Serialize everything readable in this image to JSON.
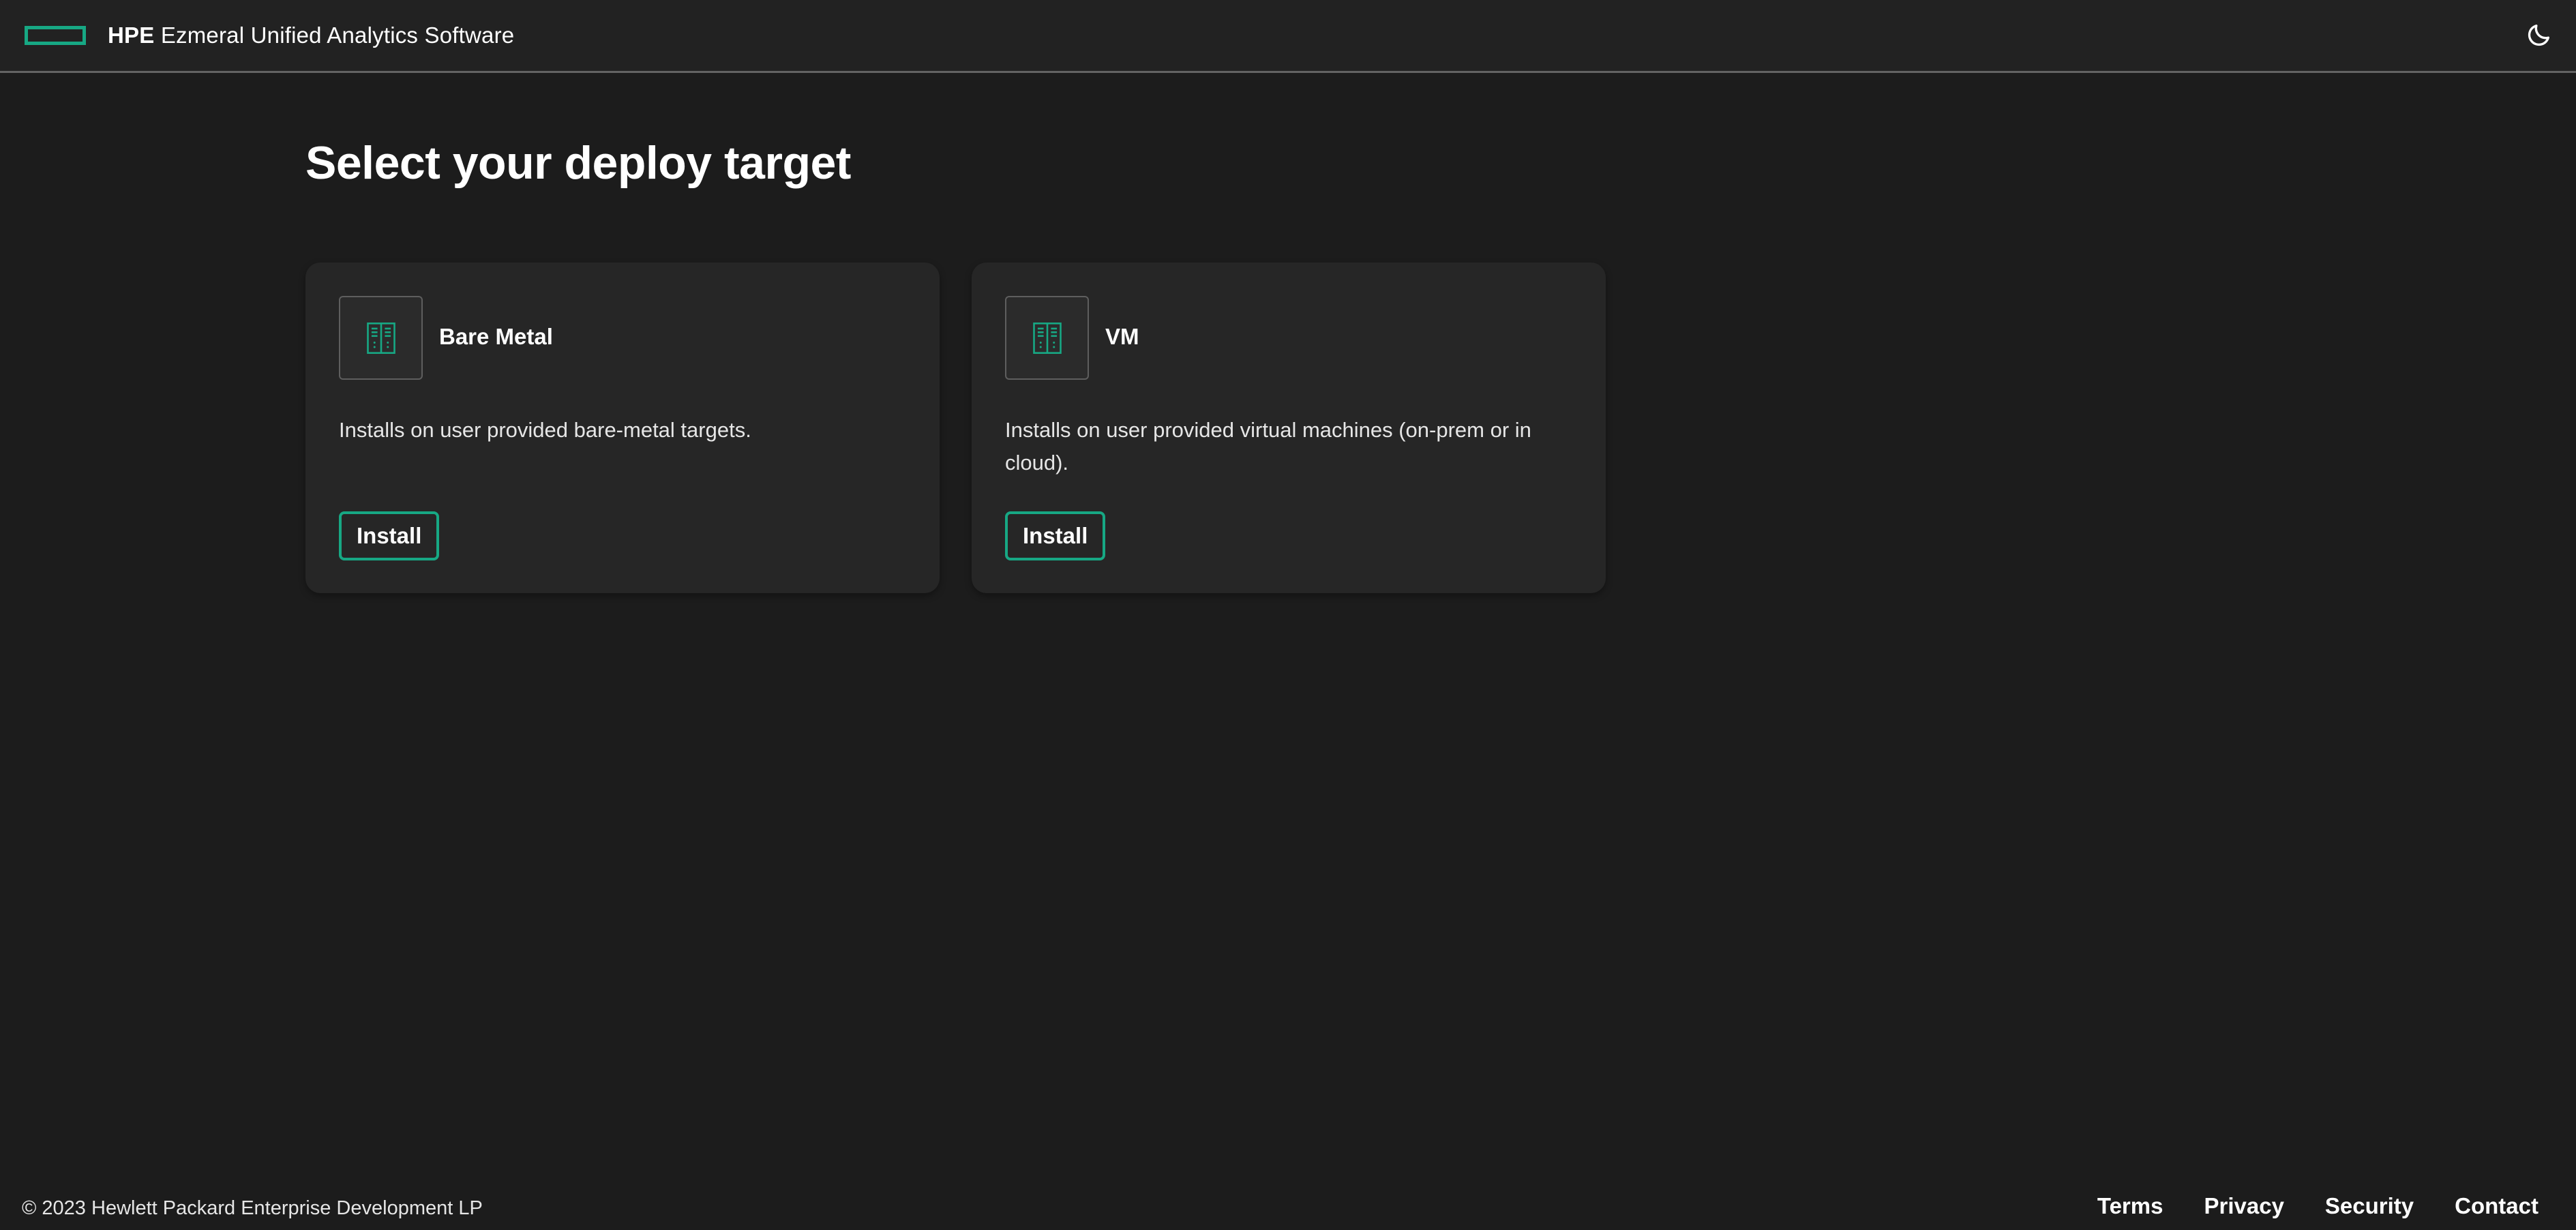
{
  "colors": {
    "background": "#1c1c1c",
    "header_background": "#222222",
    "card_background": "#262626",
    "accent": "#17a884",
    "text": "#ffffff"
  },
  "header": {
    "brand_strong": "HPE",
    "brand_rest": " Ezmeral Unified Analytics Software",
    "logo_icon": "hpe-element-logo",
    "theme_toggle_icon": "moon-icon"
  },
  "main": {
    "title": "Select your deploy target",
    "cards": [
      {
        "icon": "server-icon",
        "title": "Bare Metal",
        "description": "Installs on user provided bare-metal targets.",
        "button_label": "Install"
      },
      {
        "icon": "server-icon",
        "title": "VM",
        "description": "Installs on user provided virtual machines (on-prem or in cloud).",
        "button_label": "Install"
      }
    ]
  },
  "footer": {
    "copyright": "© 2023 Hewlett Packard Enterprise Development LP",
    "links": [
      "Terms",
      "Privacy",
      "Security",
      "Contact"
    ]
  }
}
